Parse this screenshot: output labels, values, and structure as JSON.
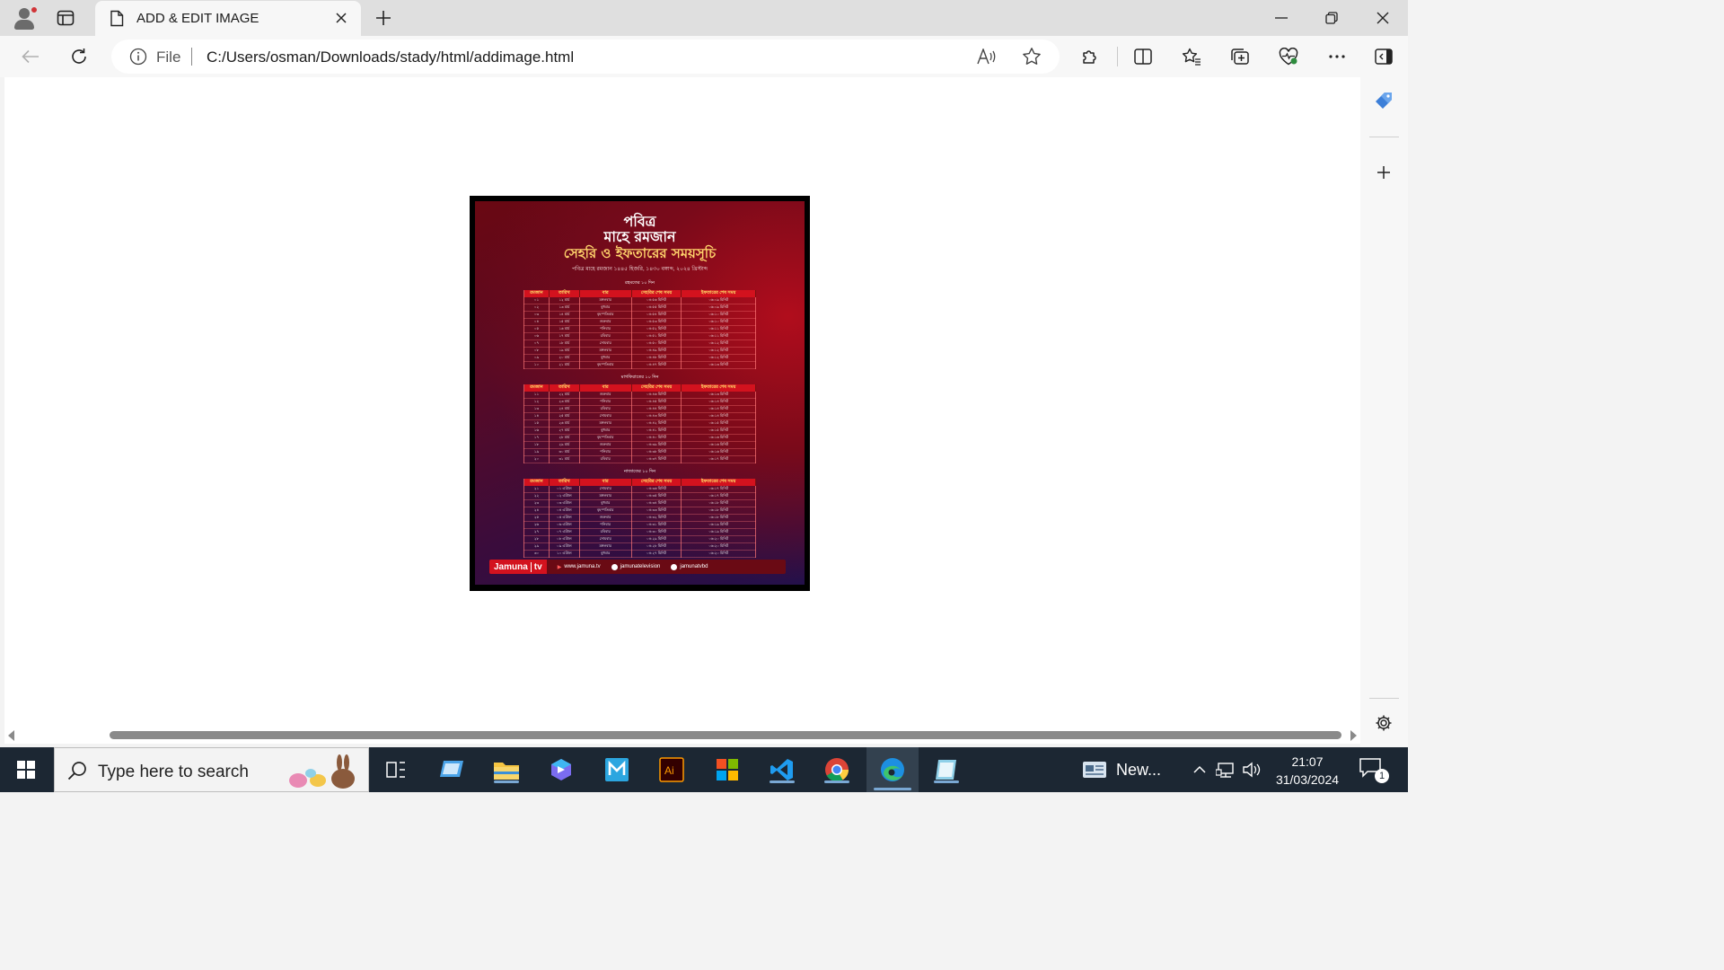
{
  "browser": {
    "tab_title": "ADD & EDIT IMAGE",
    "omnibox": {
      "scheme_label": "File",
      "url": "C:/Users/osman/Downloads/stady/html/addimage.html"
    }
  },
  "poster": {
    "heading_line1": "পবিত্র",
    "heading_line2": "মাহে রমজান",
    "heading_main": "সেহরি ও ইফতারের সময়সূচি",
    "subheading": "পবিত্র মাহে রমজান ১৪৪৫ হিজরি, ১৪৩০ বঙ্গাব্দ, ২০২৪ খ্রিস্টাব্দ",
    "columns": [
      "রমজান",
      "তারিখ",
      "বার",
      "সেহরির শেষ সময়",
      "ইফতারের শেষ সময়"
    ],
    "sections": [
      {
        "title": "রহমতের ১০ দিন",
        "rows": [
          [
            "০১",
            "১২ মার্চ",
            "মঙ্গলবার",
            "০৪:৫৬ মিনিট",
            "০৬:০৯ মিনিট"
          ],
          [
            "০২",
            "১৩ মার্চ",
            "বুধবার",
            "০৪:৫৫ মিনিট",
            "০৬:০৯ মিনিট"
          ],
          [
            "০৩",
            "১৪ মার্চ",
            "বৃহস্পতিবার",
            "০৪:৫৪ মিনিট",
            "০৬:১০ মিনিট"
          ],
          [
            "০৪",
            "১৫ মার্চ",
            "শুক্রবার",
            "০৪:৫৩ মিনিট",
            "০৬:১০ মিনিট"
          ],
          [
            "০৫",
            "১৬ মার্চ",
            "শনিবার",
            "০৪:৫২ মিনিট",
            "০৬:১১ মিনিট"
          ],
          [
            "০৬",
            "১৭ মার্চ",
            "রবিবার",
            "০৪:৫১ মিনিট",
            "০৬:১১ মিনিট"
          ],
          [
            "০৭",
            "১৮ মার্চ",
            "সোমবার",
            "০৪:৫০ মিনিট",
            "০৬:১২ মিনিট"
          ],
          [
            "০৮",
            "১৯ মার্চ",
            "মঙ্গলবার",
            "০৪:৪৯ মিনিট",
            "০৬:১২ মিনিট"
          ],
          [
            "০৯",
            "২০ মার্চ",
            "বুধবার",
            "০৪:৪৮ মিনিট",
            "০৬:১২ মিনিট"
          ],
          [
            "১০",
            "২১ মার্চ",
            "বৃহস্পতিবার",
            "০৪:৪৭ মিনিট",
            "০৬:১৩ মিনিট"
          ]
        ]
      },
      {
        "title": "মাগফিরাতের ১০ দিন",
        "rows": [
          [
            "১১",
            "২২ মার্চ",
            "শুক্রবার",
            "০৪:৪৬ মিনিট",
            "০৬:১৩ মিনিট"
          ],
          [
            "১২",
            "২৩ মার্চ",
            "শনিবার",
            "০৪:৪৫ মিনিট",
            "০৬:১৪ মিনিট"
          ],
          [
            "১৩",
            "২৪ মার্চ",
            "রবিবার",
            "০৪:৪৪ মিনিট",
            "০৬:১৪ মিনিট"
          ],
          [
            "১৪",
            "২৫ মার্চ",
            "সোমবার",
            "০৪:৪৩ মিনিট",
            "০৬:১৪ মিনিট"
          ],
          [
            "১৫",
            "২৬ মার্চ",
            "মঙ্গলবার",
            "০৪:৪২ মিনিট",
            "০৬:১৫ মিনিট"
          ],
          [
            "১৬",
            "২৭ মার্চ",
            "বুধবার",
            "০৪:৪১ মিনিট",
            "০৬:১৫ মিনিট"
          ],
          [
            "১৭",
            "২৮ মার্চ",
            "বৃহস্পতিবার",
            "০৪:৪০ মিনিট",
            "০৬:১৬ মিনিট"
          ],
          [
            "১৮",
            "২৯ মার্চ",
            "শুক্রবার",
            "০৪:৩৯ মিনিট",
            "০৬:১৬ মিনিট"
          ],
          [
            "১৯",
            "৩০ মার্চ",
            "শনিবার",
            "০৪:৩৮ মিনিট",
            "০৬:১৬ মিনিট"
          ],
          [
            "২০",
            "৩১ মার্চ",
            "রবিবার",
            "০৪:৩৭ মিনিট",
            "০৬:১৭ মিনিট"
          ]
        ]
      },
      {
        "title": "নাজাতের ১০ দিন",
        "rows": [
          [
            "২১",
            "০১ এপ্রিল",
            "সোমবার",
            "০৪:৩৬ মিনিট",
            "০৬:১৭ মিনিট"
          ],
          [
            "২২",
            "০২ এপ্রিল",
            "মঙ্গলবার",
            "০৪:৩৫ মিনিট",
            "০৬:১৭ মিনিট"
          ],
          [
            "২৩",
            "০৩ এপ্রিল",
            "বুধবার",
            "০৪:৩৪ মিনিট",
            "০৬:১৮ মিনিট"
          ],
          [
            "২৪",
            "০৪ এপ্রিল",
            "বৃহস্পতিবার",
            "০৪:৩৩ মিনিট",
            "০৬:১৮ মিনিট"
          ],
          [
            "২৫",
            "০৫ এপ্রিল",
            "শুক্রবার",
            "০৪:৩২ মিনিট",
            "০৬:১৮ মিনিট"
          ],
          [
            "২৬",
            "০৬ এপ্রিল",
            "শনিবার",
            "০৪:৩১ মিনিট",
            "০৬:১৯ মিনিট"
          ],
          [
            "২৭",
            "০৭ এপ্রিল",
            "রবিবার",
            "০৪:৩০ মিনিট",
            "০৬:১৯ মিনিট"
          ],
          [
            "২৮",
            "০৮ এপ্রিল",
            "সোমবার",
            "০৪:২৯ মিনিট",
            "০৬:২০ মিনিট"
          ],
          [
            "২৯",
            "০৯ এপ্রিল",
            "মঙ্গলবার",
            "০৪:২৮ মিনিট",
            "০৬:২০ মিনিট"
          ],
          [
            "৩০",
            "১০ এপ্রিল",
            "বুধবার",
            "০৪:২৭ মিনিট",
            "০৬:২০ মিনিট"
          ]
        ]
      }
    ],
    "footer": {
      "brand": "Jamuna",
      "brand_suffix": "tv",
      "website": "www.jamuna.tv",
      "facebook": "jamunatelevision",
      "youtube": "jamunatvbd"
    }
  },
  "taskbar": {
    "search_placeholder": "Type here to search",
    "news_label": "New...",
    "time": "21:07",
    "date": "31/03/2024",
    "notification_count": "1"
  }
}
